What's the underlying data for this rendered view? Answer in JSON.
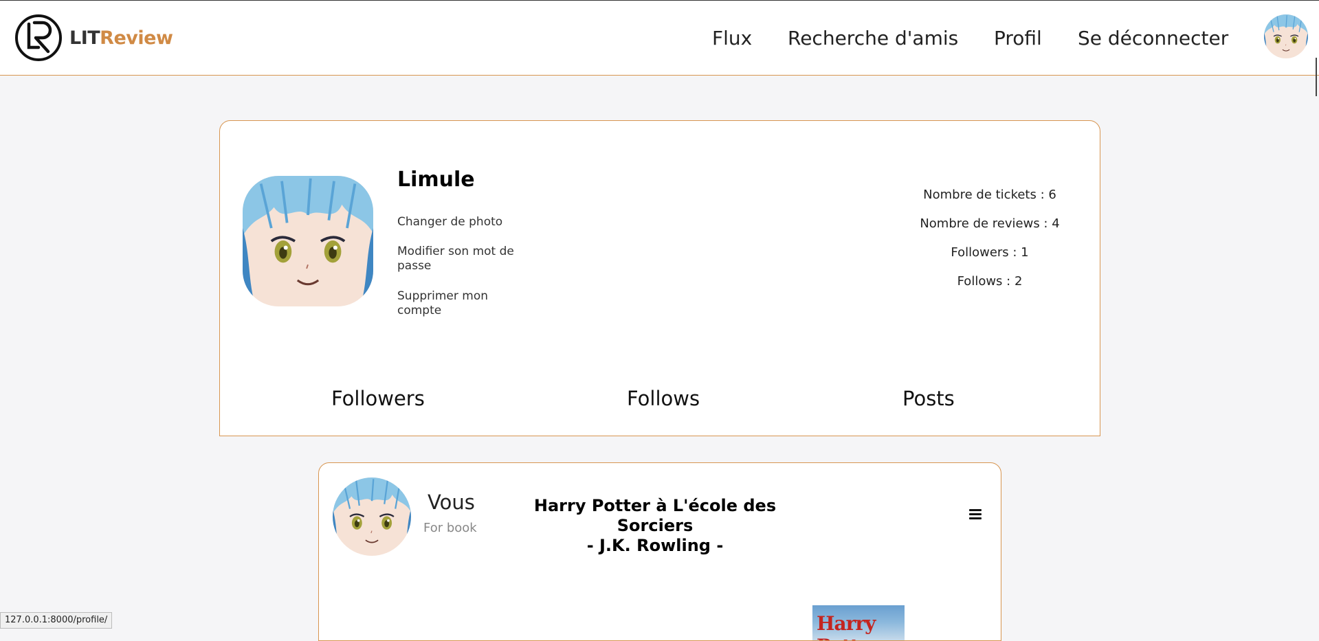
{
  "brand": {
    "lit": "LIT",
    "review": "Review"
  },
  "nav": {
    "flux": "Flux",
    "search": "Recherche d'amis",
    "profile": "Profil",
    "logout": "Se déconnecter"
  },
  "profile": {
    "username": "Limule",
    "change_photo": "Changer de photo",
    "change_password": "Modifier son mot de passe",
    "delete_account": "Supprimer mon compte",
    "stats": {
      "tickets": "Nombre de tickets : 6",
      "reviews": "Nombre de reviews : 4",
      "followers": "Followers : 1",
      "follows": "Follows : 2"
    },
    "tabs": {
      "followers": "Followers",
      "follows": "Follows",
      "posts": "Posts"
    }
  },
  "post": {
    "author": "Vous",
    "subtitle": "For book",
    "title_line1": "Harry Potter à L'école des Sorciers",
    "title_line2": "- J.K. Rowling -",
    "cover_text": "Harry Potter"
  },
  "status_url": "127.0.0.1:8000/profile/",
  "colors": {
    "accent": "#d79550",
    "background": "#f5f5f7"
  }
}
